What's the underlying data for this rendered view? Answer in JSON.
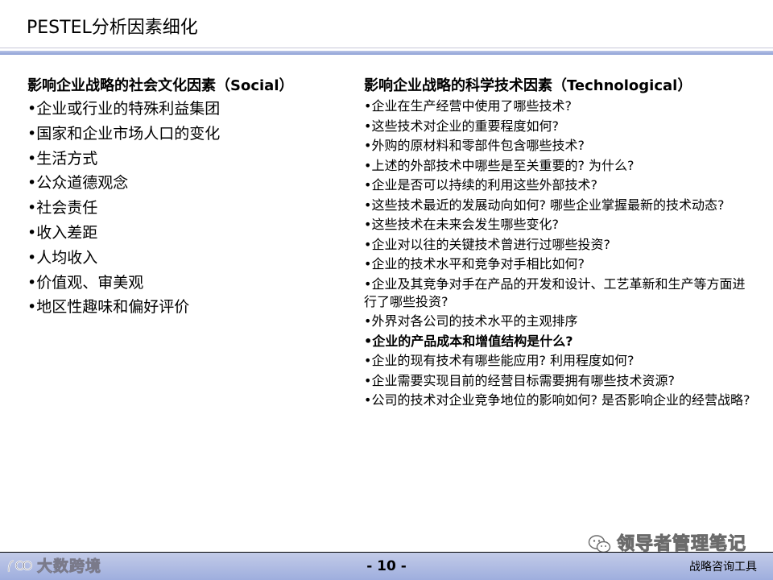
{
  "slide": {
    "title": "PESTEL分析因素细化"
  },
  "left_column": {
    "heading": "影响企业战略的社会文化因素（Social）",
    "items": [
      {
        "text": "•企业或行业的特殊利益集团"
      },
      {
        "text": "•国家和企业市场人口的变化"
      },
      {
        "text": "•生活方式"
      },
      {
        "text": "•公众道德观念"
      },
      {
        "text": "•社会责任"
      },
      {
        "text": "•收入差距"
      },
      {
        "text": "•人均收入"
      },
      {
        "text": "•价值观、审美观"
      },
      {
        "text": "•地区性趣味和偏好评价"
      }
    ]
  },
  "right_column": {
    "heading": "影响企业战略的科学技术因素（Technological）",
    "items": [
      {
        "text": "•企业在生产经营中使用了哪些技术?",
        "bold": false
      },
      {
        "text": "•这些技术对企业的重要程度如何?",
        "bold": false
      },
      {
        "text": "•外购的原材料和零部件包含哪些技术?",
        "bold": false
      },
      {
        "text": "•上述的外部技术中哪些是至关重要的? 为什么?",
        "bold": false
      },
      {
        "text": "•企业是否可以持续的利用这些外部技术?",
        "bold": false
      },
      {
        "text": "•这些技术最近的发展动向如何? 哪些企业掌握最新的技术动态?",
        "bold": false
      },
      {
        "text": "•这些技术在未来会发生哪些变化?",
        "bold": false
      },
      {
        "text": "•企业对以往的关键技术曾进行过哪些投资?",
        "bold": false
      },
      {
        "text": "•企业的技术水平和竞争对手相比如何?",
        "bold": false
      },
      {
        "text": "•企业及其竞争对手在产品的开发和设计、工艺革新和生产等方面进行了哪些投资?",
        "bold": false
      },
      {
        "text": "•外界对各公司的技术水平的主观排序",
        "bold": false
      },
      {
        "text": "•企业的产品成本和增值结构是什么?",
        "bold": true
      },
      {
        "text": "•企业的现有技术有哪些能应用? 利用程度如何?",
        "bold": false
      },
      {
        "text": "•企业需要实现目前的经营目标需要拥有哪些技术资源?",
        "bold": false
      },
      {
        "text": "•公司的技术对企业竞争地位的影响如何? 是否影响企业的经营战略?",
        "bold": false
      }
    ]
  },
  "watermark": {
    "icon": "wechat-icon",
    "text": "领导者管理笔记"
  },
  "footer": {
    "logo_text": "大数跨境",
    "page_number": "- 10 -",
    "brand": "战略咨询工具"
  },
  "colors": {
    "title_rule": "#8ea0d6",
    "footer_bar": "#aab6e0"
  }
}
